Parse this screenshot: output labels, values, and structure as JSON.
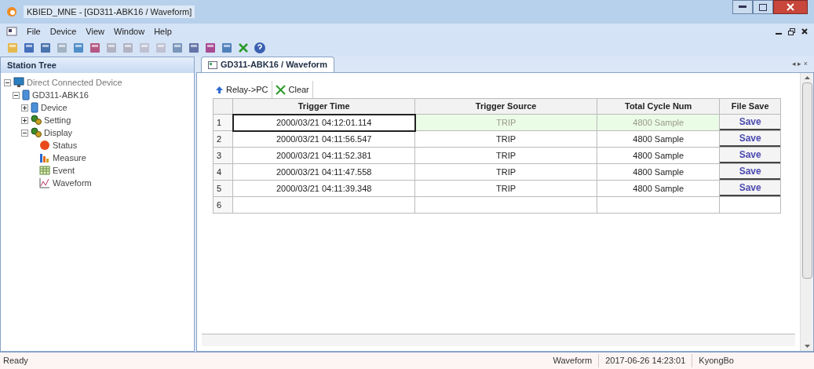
{
  "window": {
    "title": "KBIED_MNE - [GD311-ABK16 / Waveform]"
  },
  "menu": [
    "File",
    "Device",
    "View",
    "Window",
    "Help"
  ],
  "sidebar": {
    "title": "Station Tree",
    "tree": [
      {
        "label": "Direct Connected Device",
        "kind": "monitor",
        "expanded": true,
        "children": [
          {
            "label": "GD311-ABK16",
            "kind": "device",
            "expanded": true,
            "children": [
              {
                "label": "Device",
                "kind": "device",
                "expanded": false
              },
              {
                "label": "Setting",
                "kind": "gears",
                "expanded": false
              },
              {
                "label": "Display",
                "kind": "gears",
                "expanded": true,
                "children": [
                  {
                    "label": "Status",
                    "kind": "status"
                  },
                  {
                    "label": "Measure",
                    "kind": "bars"
                  },
                  {
                    "label": "Event",
                    "kind": "grid"
                  },
                  {
                    "label": "Waveform",
                    "kind": "wave"
                  }
                ]
              }
            ]
          }
        ]
      }
    ]
  },
  "document_tab": {
    "label": "GD311-ABK16 / Waveform",
    "selected": true
  },
  "tab_nav": "◂ ▸ ×",
  "actions": [
    "Relay->PC",
    "Clear"
  ],
  "table": {
    "columns": [
      "Trigger Time",
      "Trigger Source",
      "Total Cycle Num",
      "File Save"
    ],
    "rows": [
      {
        "index": "1",
        "trigger_time": "2000/03/21 04:12:01.114",
        "trigger_source": "TRIP",
        "total_cycle_num": "4800 Sample",
        "file_save": "Save",
        "selected": true
      },
      {
        "index": "2",
        "trigger_time": "2000/03/21 04:11:56.547",
        "trigger_source": "TRIP",
        "total_cycle_num": "4800 Sample",
        "file_save": "Save",
        "selected": false
      },
      {
        "index": "3",
        "trigger_time": "2000/03/21 04:11:52.381",
        "trigger_source": "TRIP",
        "total_cycle_num": "4800 Sample",
        "file_save": "Save",
        "selected": false
      },
      {
        "index": "4",
        "trigger_time": "2000/03/21 04:11:47.558",
        "trigger_source": "TRIP",
        "total_cycle_num": "4800 Sample",
        "file_save": "Save",
        "selected": false
      },
      {
        "index": "5",
        "trigger_time": "2000/03/21 04:11:39.348",
        "trigger_source": "TRIP",
        "total_cycle_num": "4800 Sample",
        "file_save": "Save",
        "selected": false
      },
      {
        "index": "6",
        "selected": false
      }
    ]
  },
  "status_bar": {
    "left": "Ready",
    "view": "Waveform",
    "datetime": "2017-06-26 14:23:01",
    "user": "KyongBo"
  }
}
